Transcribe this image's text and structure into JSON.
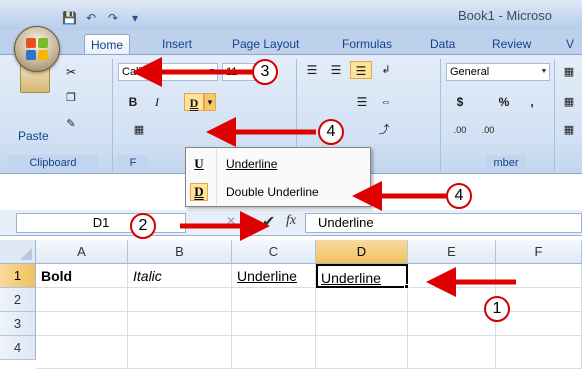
{
  "window": {
    "title": "Book1 - Microso"
  },
  "ribbon": {
    "tabs": [
      "Home",
      "Insert",
      "Page Layout",
      "Formulas",
      "Data",
      "Review",
      "V"
    ],
    "clipboard": {
      "paste_label": "Paste",
      "group_label": "Clipboard"
    },
    "font": {
      "font_name": "Calibri",
      "font_size": "11",
      "group_label": "F"
    },
    "number": {
      "format": "General",
      "currency": "$",
      "percent": "%",
      "comma": ",",
      "inc_decimal": ".00",
      "dec_decimal": ".00",
      "group_label": "mber"
    }
  },
  "dropdown": {
    "items": [
      {
        "icon_glyph": "U",
        "label": "Underline"
      },
      {
        "icon_glyph": "D",
        "label": "Double Underline"
      }
    ]
  },
  "formula_bar": {
    "name_box": "D1",
    "fx": "fx",
    "value": "Underline"
  },
  "grid": {
    "columns": [
      "A",
      "B",
      "C",
      "D",
      "E",
      "F"
    ],
    "rows": [
      "1",
      "2",
      "3",
      "4"
    ],
    "row1": {
      "A": "Bold",
      "B": "Italic",
      "C": "Underline",
      "D": "Underline"
    }
  },
  "callouts": [
    "1",
    "2",
    "3",
    "4",
    "4"
  ],
  "colors": {
    "arrow": "#e00000",
    "selection": "#f1c15f",
    "ribbon": "#d2e1f4"
  }
}
